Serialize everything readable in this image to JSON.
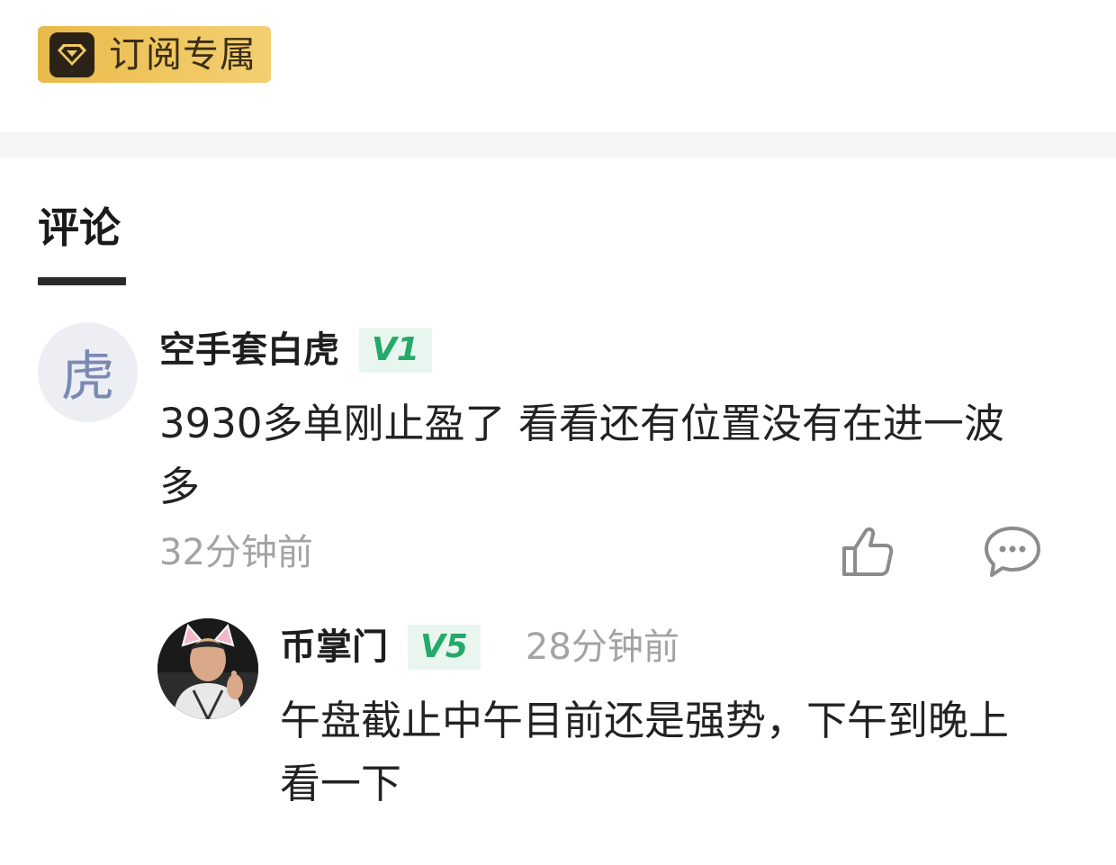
{
  "subscription": {
    "label": "订阅专属",
    "icon": "diamond-icon",
    "color": "#f0c862"
  },
  "tabs": {
    "comments_label": "评论"
  },
  "comment": {
    "avatar_char": "虎",
    "username": "空手套白虎",
    "level": "V1",
    "text_line1": "3930多单刚止盈了 看看还有位置没有在进一波",
    "text_line2": "多",
    "time": "32分钟前",
    "like_icon": "thumbs-up-icon",
    "reply_icon": "comment-bubble-icon"
  },
  "reply": {
    "username": "币掌门",
    "level": "V5",
    "time": "28分钟前",
    "text_line1": "午盘截止中午目前还是强势，下午到晚上",
    "text_line2": "看一下"
  },
  "colors": {
    "level_text": "#25a96a",
    "level_bg": "#e9f6ef",
    "muted_text": "#a3a3a3"
  }
}
